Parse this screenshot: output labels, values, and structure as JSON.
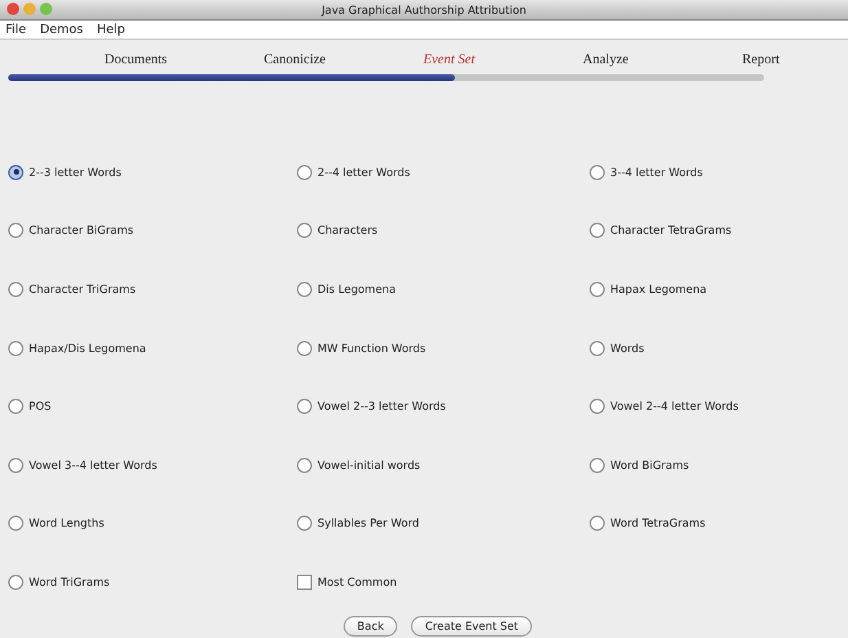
{
  "window": {
    "title": "Java Graphical Authorship Attribution"
  },
  "menu": [
    "File",
    "Demos",
    "Help"
  ],
  "steps": [
    {
      "label": "Documents",
      "selected": false
    },
    {
      "label": "Canonicize",
      "selected": false
    },
    {
      "label": "Event Set",
      "selected": true
    },
    {
      "label": "Analyze",
      "selected": false
    },
    {
      "label": "Report",
      "selected": false
    }
  ],
  "progress": {
    "level": 0.59
  },
  "options": [
    {
      "kind": "radio",
      "label": "2--3 letter Words",
      "selected": true
    },
    {
      "kind": "radio",
      "label": "2--4 letter Words",
      "selected": false
    },
    {
      "kind": "radio",
      "label": "3--4 letter Words",
      "selected": false
    },
    {
      "kind": "radio",
      "label": "Character BiGrams",
      "selected": false
    },
    {
      "kind": "radio",
      "label": "Characters",
      "selected": false
    },
    {
      "kind": "radio",
      "label": "Character TetraGrams",
      "selected": false
    },
    {
      "kind": "radio",
      "label": "Character TriGrams",
      "selected": false
    },
    {
      "kind": "radio",
      "label": "Dis Legomena",
      "selected": false
    },
    {
      "kind": "radio",
      "label": "Hapax Legomena",
      "selected": false
    },
    {
      "kind": "radio",
      "label": "Hapax/Dis Legomena",
      "selected": false
    },
    {
      "kind": "radio",
      "label": "MW Function Words",
      "selected": false
    },
    {
      "kind": "radio",
      "label": "Words",
      "selected": false
    },
    {
      "kind": "radio",
      "label": "POS",
      "selected": false
    },
    {
      "kind": "radio",
      "label": "Vowel 2--3 letter Words",
      "selected": false
    },
    {
      "kind": "radio",
      "label": "Vowel 2--4 letter Words",
      "selected": false
    },
    {
      "kind": "radio",
      "label": "Vowel 3--4 letter Words",
      "selected": false
    },
    {
      "kind": "radio",
      "label": "Vowel-initial words",
      "selected": false
    },
    {
      "kind": "radio",
      "label": "Word BiGrams",
      "selected": false
    },
    {
      "kind": "radio",
      "label": "Word Lengths",
      "selected": false
    },
    {
      "kind": "radio",
      "label": "Syllables Per Word",
      "selected": false
    },
    {
      "kind": "radio",
      "label": "Word TetraGrams",
      "selected": false
    },
    {
      "kind": "radio",
      "label": "Word TriGrams",
      "selected": false
    },
    {
      "kind": "checkbox",
      "label": "Most Common",
      "checked": false
    }
  ],
  "buttons": [
    "Back",
    "Create Event Set"
  ]
}
